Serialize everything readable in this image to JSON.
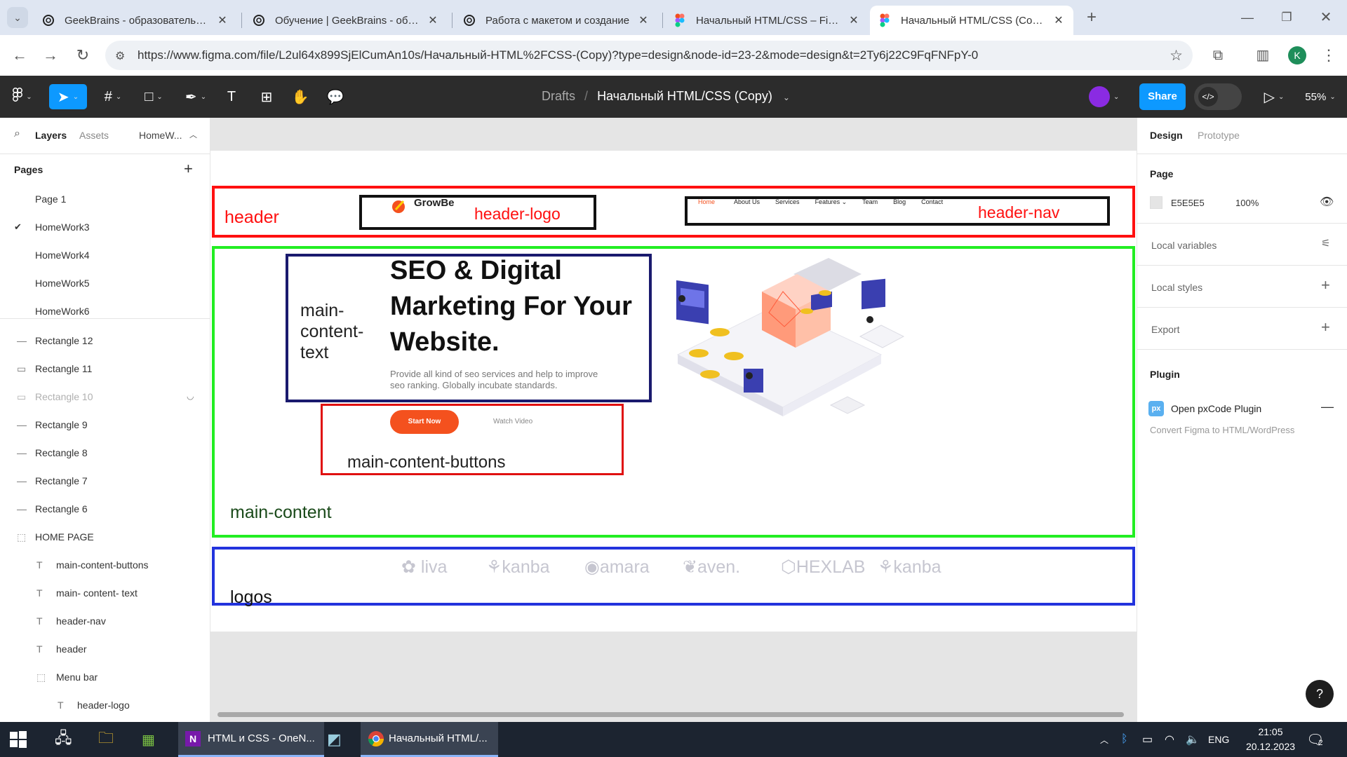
{
  "browser": {
    "tabs": [
      {
        "title": "GeekBrains - образовательный"
      },
      {
        "title": "Обучение | GeekBrains - образ"
      },
      {
        "title": "Работа с макетом и создание"
      },
      {
        "title": "Начальный HTML/CSS – Figma"
      },
      {
        "title": "Начальный HTML/CSS (Copy) -"
      }
    ],
    "url": "https://www.figma.com/file/L2ul64x899SjElCumAn10s/Начальный-HTML%2FCSS-(Copy)?type=design&node-id=23-2&mode=design&t=2Ty6j22C9FqFNFpY-0",
    "profile_initial": "K"
  },
  "figma": {
    "breadcrumb_root": "Drafts",
    "breadcrumb_sep": "/",
    "file_name": "Начальный HTML/CSS (Copy)",
    "share_label": "Share",
    "zoom": "55%",
    "left_panel": {
      "tabs": [
        "Layers",
        "Assets"
      ],
      "page_selector": "HomeW...",
      "pages_title": "Pages",
      "pages": [
        "Page 1",
        "HomeWork3",
        "HomeWork4",
        "HomeWork5",
        "HomeWork6"
      ],
      "current_page": "HomeWork3",
      "layers": [
        "Rectangle 12",
        "Rectangle 11",
        "Rectangle 10",
        "Rectangle 9",
        "Rectangle 8",
        "Rectangle 7",
        "Rectangle 6",
        "HOME PAGE",
        "main-content-buttons",
        "main- content- text",
        "header-nav",
        "header",
        "Menu bar",
        "header-logo"
      ]
    },
    "right_panel": {
      "tabs": [
        "Design",
        "Prototype"
      ],
      "page_title": "Page",
      "page_color": "E5E5E5",
      "page_opacity": "100%",
      "local_variables": "Local variables",
      "local_styles": "Local styles",
      "export": "Export",
      "plugin_title": "Plugin",
      "plugin_name": "Open pxCode Plugin",
      "plugin_desc": "Convert Figma to HTML/WordPress",
      "help": "?"
    },
    "canvas": {
      "logo_text": "GrowBe",
      "nav_items": [
        "Home",
        "About Us",
        "Services",
        "Features ⌄",
        "Team",
        "Blog",
        "Contact"
      ],
      "hero_title": [
        "SEO & Digital",
        "Marketing For Your",
        "Website."
      ],
      "hero_text": [
        "Provide all kind of seo services and help to improve",
        "seo ranking. Globally incubate standards."
      ],
      "start_btn": "Start Now",
      "watch_btn": "Watch Video",
      "brands": [
        "liva",
        "kanba",
        "amara",
        "aven.",
        "HEXLAB",
        "kanba"
      ],
      "annotations": {
        "header": "header",
        "header_logo": "header-logo",
        "header_nav": "header-nav",
        "main_text": [
          "main-",
          "content-",
          "text"
        ],
        "main_buttons": "main-content-buttons",
        "main_content": "main-content",
        "logos": "logos"
      },
      "colors": {
        "red": "#ff1010",
        "green": "#22ee22",
        "blue": "#2233dd",
        "navy": "#1a1a6e",
        "orange": "#f4511e"
      }
    }
  },
  "taskbar": {
    "apps": [
      "HTML и CSS - OneN...",
      "Начальный HTML/..."
    ],
    "lang": "ENG",
    "time": "21:05",
    "date": "20.12.2023",
    "notif_count": "2"
  }
}
